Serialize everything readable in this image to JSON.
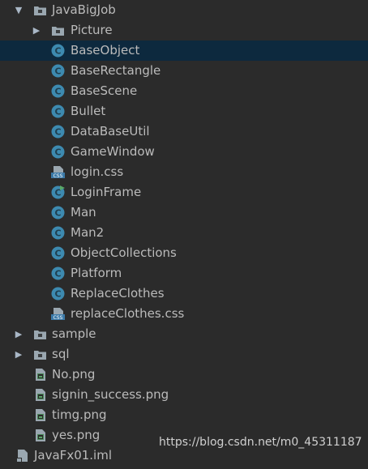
{
  "tree": [
    {
      "label": "JavaBigJob",
      "type": "folder",
      "level": 0,
      "expanded": true,
      "icon": "folder-open-icon"
    },
    {
      "label": "Picture",
      "type": "folder",
      "level": 1,
      "expanded": false,
      "icon": "folder-icon"
    },
    {
      "label": "BaseObject",
      "type": "class",
      "level": 1,
      "selected": true,
      "icon": "java-class-icon"
    },
    {
      "label": "BaseRectangle",
      "type": "class",
      "level": 1,
      "icon": "java-class-icon"
    },
    {
      "label": "BaseScene",
      "type": "class",
      "level": 1,
      "icon": "java-class-icon"
    },
    {
      "label": "Bullet",
      "type": "class",
      "level": 1,
      "icon": "java-class-icon"
    },
    {
      "label": "DataBaseUtil",
      "type": "class",
      "level": 1,
      "icon": "java-class-icon"
    },
    {
      "label": "GameWindow",
      "type": "class",
      "level": 1,
      "icon": "java-class-icon"
    },
    {
      "label": "login.css",
      "type": "css",
      "level": 1,
      "icon": "css-file-icon"
    },
    {
      "label": "LoginFrame",
      "type": "main-class",
      "level": 1,
      "icon": "java-main-class-icon"
    },
    {
      "label": "Man",
      "type": "class",
      "level": 1,
      "icon": "java-class-icon"
    },
    {
      "label": "Man2",
      "type": "class",
      "level": 1,
      "icon": "java-class-icon"
    },
    {
      "label": "ObjectCollections",
      "type": "class",
      "level": 1,
      "icon": "java-class-icon"
    },
    {
      "label": "Platform",
      "type": "class",
      "level": 1,
      "icon": "java-class-icon"
    },
    {
      "label": "ReplaceClothes",
      "type": "class",
      "level": 1,
      "icon": "java-class-icon"
    },
    {
      "label": "replaceClothes.css",
      "type": "css",
      "level": 1,
      "icon": "css-file-icon"
    },
    {
      "label": "sample",
      "type": "folder",
      "level": 0,
      "expanded": false,
      "icon": "folder-icon"
    },
    {
      "label": "sql",
      "type": "folder",
      "level": 0,
      "expanded": false,
      "icon": "folder-icon"
    },
    {
      "label": "No.png",
      "type": "image",
      "level": 0,
      "icon": "image-file-icon"
    },
    {
      "label": "signin_success.png",
      "type": "image",
      "level": 0,
      "icon": "image-file-icon"
    },
    {
      "label": "timg.png",
      "type": "image",
      "level": 0,
      "icon": "image-file-icon"
    },
    {
      "label": "yes.png",
      "type": "image",
      "level": 0,
      "icon": "image-file-icon"
    },
    {
      "label": "JavaFx01.iml",
      "type": "iml",
      "level": -1,
      "icon": "iml-file-icon"
    }
  ],
  "watermark": "https://blog.csdn.net/m0_45311187",
  "colors": {
    "background": "#2b2b2b",
    "selection": "#0d293e",
    "text": "#bbbbbb",
    "class_icon": "#3d8ab0",
    "folder_icon": "#9aa7b0"
  }
}
